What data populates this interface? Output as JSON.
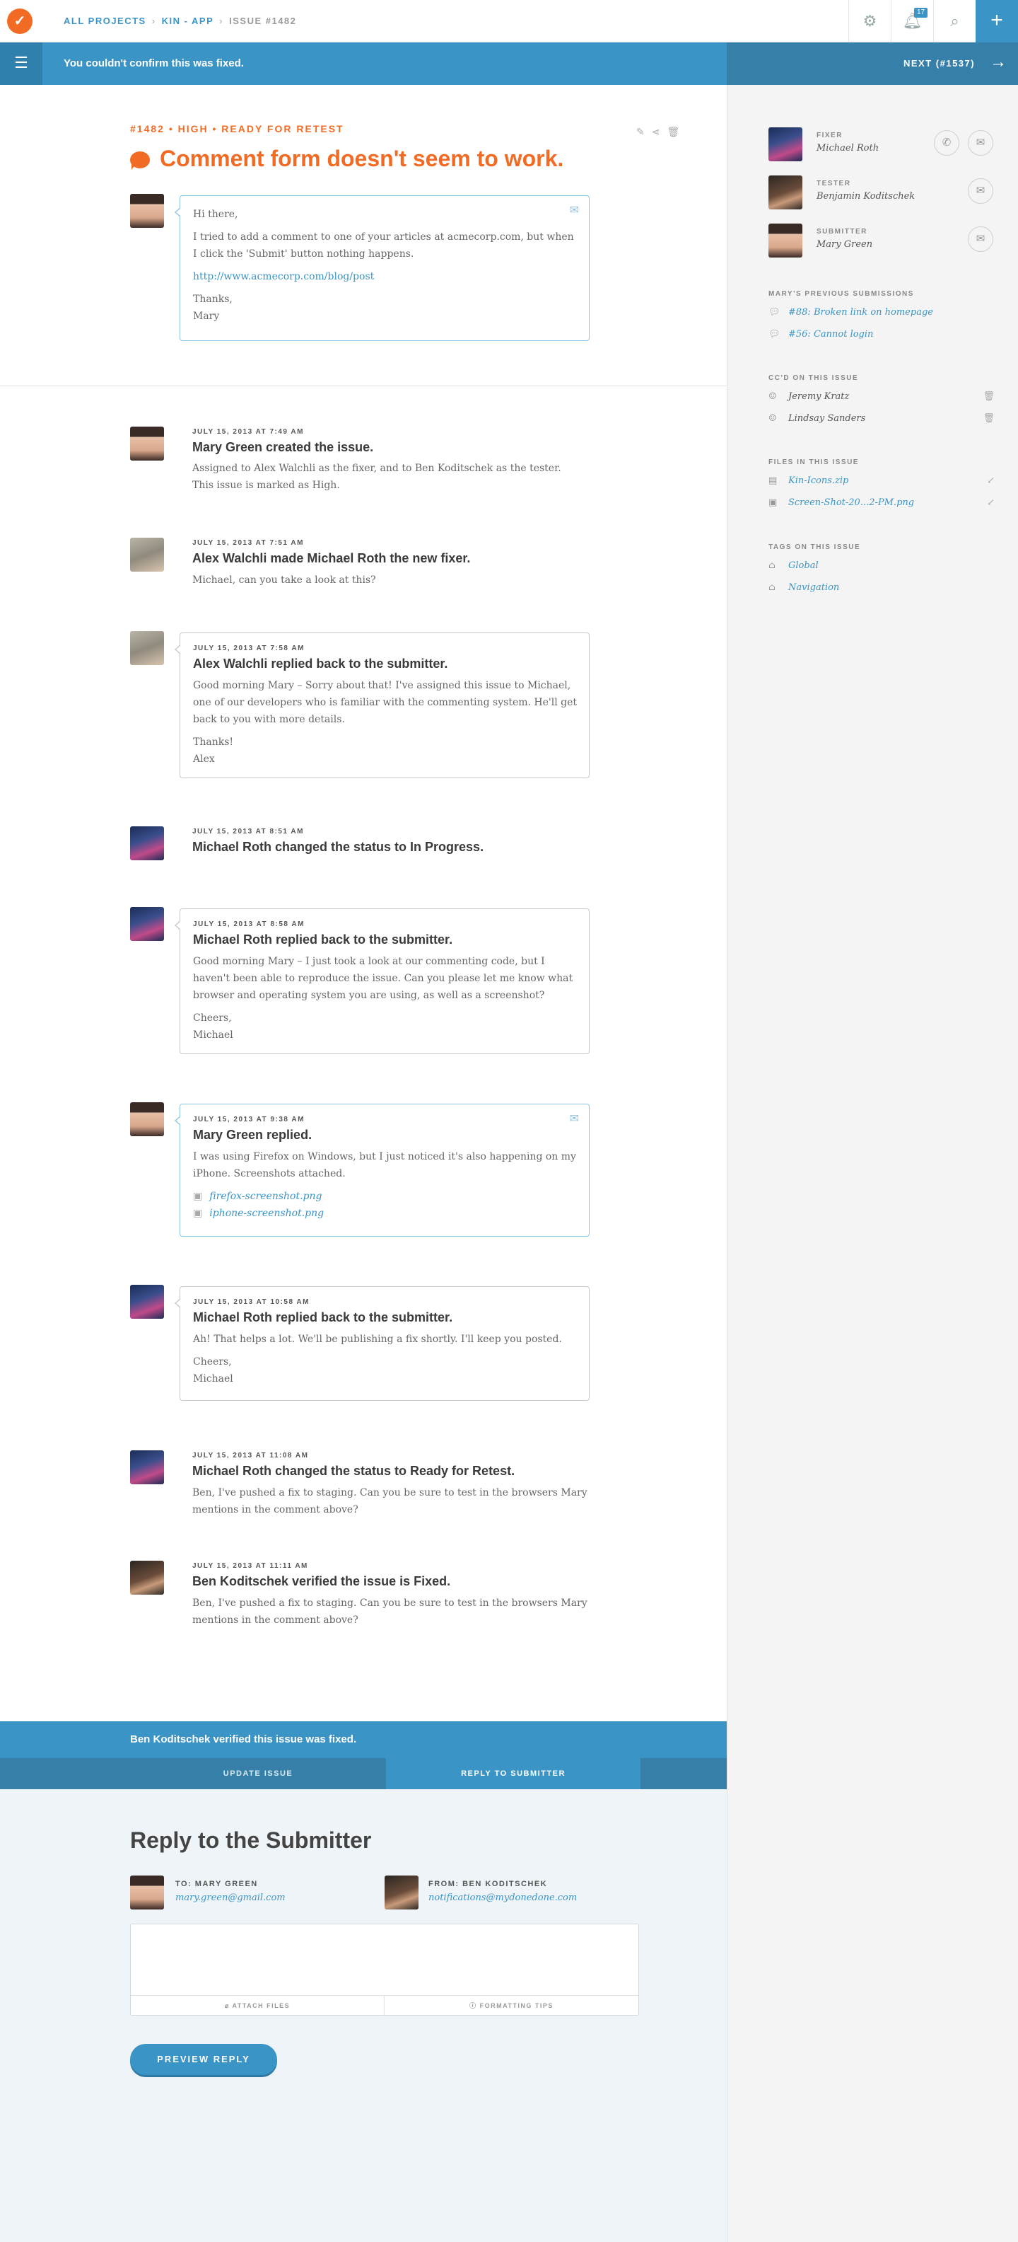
{
  "header": {
    "crumbs": [
      "ALL PROJECTS",
      "KIN - APP",
      "ISSUE #1482"
    ],
    "notif_count": "17"
  },
  "alert": {
    "message": "You couldn't confirm this was fixed.",
    "next": "NEXT (#1537)"
  },
  "issue": {
    "meta": "#1482 • HIGH • READY FOR RETEST",
    "title": "Comment form doesn't seem to work.",
    "greeting": "Hi there,",
    "body": "I tried to add a comment to one of your articles at acmecorp.com, but when I click the 'Submit' button nothing happens.",
    "link": "http://www.acmecorp.com/blog/post",
    "signoff": "Thanks,",
    "signature": "Mary"
  },
  "events": [
    {
      "date": "JULY 15, 2013 AT 7:49 AM",
      "title": "Mary Green created the issue.",
      "body1": "Assigned to Alex Walchli as the fixer, and to Ben Koditschek as the tester.",
      "body2": "This issue is marked as High."
    },
    {
      "date": "JULY 15, 2013 AT 7:51 AM",
      "title": "Alex Walchli made Michael Roth the new fixer.",
      "body1": "Michael, can you take a look at this?"
    },
    {
      "date": "JULY 15, 2013 AT 7:58 AM",
      "title": "Alex Walchli replied back to the submitter.",
      "body1": "Good morning Mary – Sorry about that! I've assigned this issue to Michael, one of our developers who is familiar with the commenting system. He'll get back to you with more details.",
      "signoff": "Thanks!",
      "signature": "Alex"
    },
    {
      "date": "JULY 15, 2013 AT 8:51 AM",
      "title": "Michael Roth changed the status to In Progress."
    },
    {
      "date": "JULY 15, 2013 AT 8:58 AM",
      "title": "Michael Roth replied back to the submitter.",
      "body1": "Good morning Mary – I just took a look at our commenting code, but I haven't been able to reproduce the issue. Can you please let me know what browser and operating system you are using, as well as a screenshot?",
      "signoff": "Cheers,",
      "signature": "Michael"
    },
    {
      "date": "JULY 15, 2013 AT 9:38 AM",
      "title": "Mary Green replied.",
      "body1": "I was using Firefox on Windows, but I just noticed it's also happening on my iPhone. Screenshots attached.",
      "file1": "firefox-screenshot.png",
      "file2": "iphone-screenshot.png"
    },
    {
      "date": "JULY 15, 2013 AT 10:58 AM",
      "title": "Michael Roth replied back to the submitter.",
      "body1": "Ah! That helps a lot. We'll be publishing a fix shortly. I'll keep you posted.",
      "signoff": "Cheers,",
      "signature": "Michael"
    },
    {
      "date": "JULY 15, 2013 AT 11:08 AM",
      "title": "Michael Roth changed the status to Ready for Retest.",
      "body1": "Ben, I've pushed a fix to staging. Can you be sure to test in the browsers Mary mentions in the comment above?"
    },
    {
      "date": "JULY 15, 2013 AT 11:11 AM",
      "title": "Ben Koditschek verified the issue is Fixed.",
      "body1": "Ben, I've pushed a fix to staging. Can you be sure to test in the browsers Mary mentions in the comment above?"
    }
  ],
  "status": {
    "message": "Ben Koditschek verified this issue was fixed.",
    "tab_update": "UPDATE ISSUE",
    "tab_reply": "REPLY TO SUBMITTER"
  },
  "reply": {
    "heading": "Reply to the Submitter",
    "to_label": "TO: MARY GREEN",
    "to_email": "mary.green@gmail.com",
    "from_label": "FROM: BEN KODITSCHEK",
    "from_email": "notifications@mydonedone.com",
    "attach": "ATTACH FILES",
    "tips": "FORMATTING TIPS",
    "preview": "PREVIEW REPLY"
  },
  "sidebar": {
    "people": [
      {
        "role": "FIXER",
        "name": "Michael Roth"
      },
      {
        "role": "TESTER",
        "name": "Benjamin Koditschek"
      },
      {
        "role": "SUBMITTER",
        "name": "Mary Green"
      }
    ],
    "prev_heading": "MARY'S PREVIOUS SUBMISSIONS",
    "prev": [
      "#88: Broken link on homepage",
      "#56: Cannot login"
    ],
    "cc_heading": "CC'D ON THIS ISSUE",
    "cc": [
      "Jeremy Kratz",
      "Lindsay Sanders"
    ],
    "files_heading": "FILES IN THIS ISSUE",
    "files": [
      "Kin-Icons.zip",
      "Screen-Shot-20...2-PM.png"
    ],
    "tags_heading": "TAGS ON THIS ISSUE",
    "tags": [
      "Global",
      "Navigation"
    ]
  },
  "colors": {
    "accent": "#f26b24",
    "primary": "#3b94c6"
  }
}
